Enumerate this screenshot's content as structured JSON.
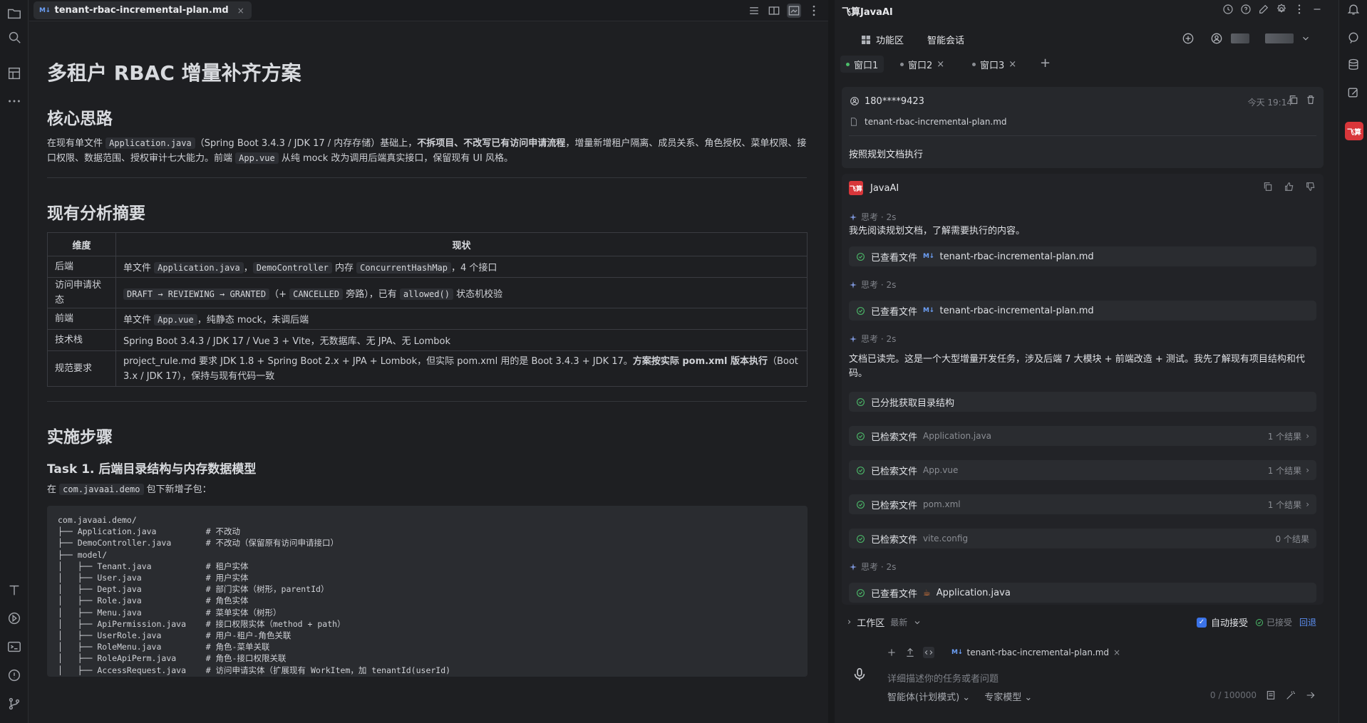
{
  "editor": {
    "tab": {
      "badge": "M↓",
      "filename": "tenant-rbac-incremental-plan.md",
      "close": "×"
    }
  },
  "doc": {
    "h1": "多租户 RBAC 增量补齐方案",
    "s1": {
      "title": "核心思路",
      "p1_a": "在现有单文件 ",
      "p1_code1": "Application.java",
      "p1_b": "（Spring Boot 3.4.3 / JDK 17 / 内存存储）基础上，",
      "p1_bold": "不拆项目、不改写已有访问申请流程",
      "p1_c": "，增量新增租户隔离、成员关系、角色授权、菜单权限、接口权限、数据范围、授权审计七大能力。前端 ",
      "p1_code2": "App.vue",
      "p1_d": " 从纯 mock 改为调用后端真实接口，保留现有 UI 风格。"
    },
    "s2": {
      "title": "现有分析摘要",
      "th_dim": "维度",
      "th_status": "现状",
      "r1": {
        "dim": "后端",
        "a": "单文件 ",
        "c1": "Application.java",
        "b": "，",
        "c2": "DemoController",
        "c": " 内存 ",
        "c3": "ConcurrentHashMap",
        "d": "，4 个接口"
      },
      "r2": {
        "dim": "访问申请状态",
        "c1": "DRAFT → REVIEWING → GRANTED",
        "a": "（+ ",
        "c2": "CANCELLED",
        "b": " 旁路），已有 ",
        "c3": "allowed()",
        "c": " 状态机校验"
      },
      "r3": {
        "dim": "前端",
        "a": "单文件 ",
        "c1": "App.vue",
        "b": "，纯静态 mock，未调后端"
      },
      "r4": {
        "dim": "技术栈",
        "text": "Spring Boot 3.4.3 / JDK 17 / Vue 3 + Vite，无数据库、无 JPA、无 Lombok"
      },
      "r5": {
        "dim": "规范要求",
        "a": "project_rule.md 要求 JDK 1.8 + Spring Boot 2.x + JPA + Lombok，但实际 pom.xml 用的是 Boot 3.4.3 + JDK 17。",
        "bold": "方案按实际 pom.xml 版本执行",
        "b": "（Boot 3.x / JDK 17），保持与现有代码一致"
      }
    },
    "s3": {
      "title": "实施步骤",
      "task1": "Task 1. 后端目录结构与内存数据模型",
      "p_a": "在 ",
      "p_code": "com.javaai.demo",
      "p_b": " 包下新增子包：",
      "code": "com.javaai.demo/\n├── Application.java          # 不改动\n├── DemoController.java       # 不改动（保留原有访问申请接口）\n├── model/\n│   ├── Tenant.java           # 租户实体\n│   ├── User.java             # 用户实体\n│   ├── Dept.java             # 部门实体（树形，parentId）\n│   ├── Role.java             # 角色实体\n│   ├── Menu.java             # 菜单实体（树形）\n│   ├── ApiPermission.java    # 接口权限实体（method + path）\n│   ├── UserRole.java         # 用户-租户-角色关联\n│   ├── RoleMenu.java         # 角色-菜单关联\n│   ├── RoleApiPerm.java      # 角色-接口权限关联\n│   ├── AccessRequest.java    # 访问申请实体（扩展现有 WorkItem，加 tenantId(userId)"
    }
  },
  "ai": {
    "title": "飞算JavaAI",
    "nav_features": "功能区",
    "nav_chat": "智能会话",
    "windows": [
      {
        "label": "窗口1"
      },
      {
        "label": "窗口2",
        "close": "×"
      },
      {
        "label": "窗口3",
        "close": "×"
      }
    ],
    "add_window": "+",
    "user": {
      "id": "180****9423",
      "time": "今天 19:14",
      "file": "tenant-rbac-incremental-plan.md",
      "message": "按照规划文档执行"
    },
    "assistant": {
      "logo": "飞算",
      "name": "JavaAI",
      "think": "思考 · 2s",
      "text1": "我先阅读规划文档，了解需要执行的内容。",
      "text2": "文档已读完。这是一个大型增量开发任务，涉及后端 7 大模块 + 前端改造 + 测试。我先了解现有项目结构和代码。",
      "viewed_label": "已查看文件",
      "md_badge": "M↓",
      "plan_file": "tenant-rbac-incremental-plan.md",
      "dir_step": "已分批获取目录结构",
      "search_label": "已检索文件",
      "searches": [
        {
          "file": "Application.java",
          "result": "1 个结果"
        },
        {
          "file": "App.vue",
          "result": "1 个结果"
        },
        {
          "file": "pom.xml",
          "result": "1 个结果"
        },
        {
          "file": "vite.config",
          "result": "0 个结果"
        }
      ],
      "java_file": "Application.java"
    },
    "workbar": {
      "label": "工作区",
      "latest": "最新",
      "auto_accept": "自动接受",
      "accepted": "已接受",
      "rollback": "回退"
    },
    "composer": {
      "chip_badge": "M↓",
      "chip_file": "tenant-rbac-incremental-plan.md",
      "chip_close": "×",
      "placeholder": "详细描述你的任务或者问题",
      "agent_mode": "智能体(计划模式)",
      "model": "专家模型",
      "counter": "0 / 100000"
    }
  },
  "strip": {
    "app_logo": "飞算"
  }
}
